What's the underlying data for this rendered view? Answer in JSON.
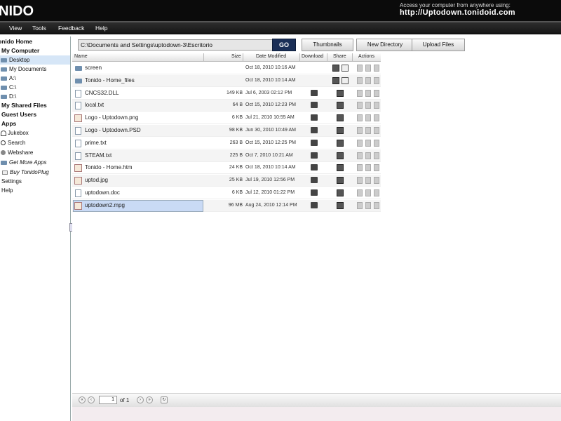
{
  "header": {
    "logo": "NIDO",
    "access_text": "Access your computer from anywhere using:",
    "access_url": "http://Uptodown.tonidoid.com"
  },
  "menu": [
    "View",
    "Tools",
    "Feedback",
    "Help"
  ],
  "sidebar": {
    "items": [
      {
        "label": "onido Home",
        "style": "bold"
      },
      {
        "label": "My Computer",
        "style": "bold"
      },
      {
        "label": "Desktop",
        "style": "selected",
        "icon": "folder-icon"
      },
      {
        "label": "My Documents",
        "icon": "folder-icon"
      },
      {
        "label": "A:\\",
        "icon": "drive-icon"
      },
      {
        "label": "C:\\",
        "icon": "drive-icon"
      },
      {
        "label": "D:\\",
        "icon": "drive-icon"
      },
      {
        "label": "My Shared Files",
        "style": "bold"
      },
      {
        "label": "Guest Users",
        "style": "bold"
      },
      {
        "label": "Apps",
        "style": "bold"
      },
      {
        "label": "Jukebox",
        "icon": "headphones-icon"
      },
      {
        "label": "Search",
        "icon": "magnifier-icon"
      },
      {
        "label": "Webshare",
        "icon": "webshare-icon"
      },
      {
        "label": "Get More Apps",
        "style": "italic",
        "icon": "apps-icon"
      },
      {
        "label": "Buy TonidoPlug",
        "style": "italic",
        "icon": "plug-icon"
      },
      {
        "label": "Settings"
      },
      {
        "label": "Help"
      }
    ]
  },
  "toolbar": {
    "path": "C:\\Documents and Settings\\uptodown-3\\Escritorio",
    "go_label": "GO",
    "thumbnails_label": "Thumbnails",
    "new_directory_label": "New Directory",
    "upload_label": "Upload Files"
  },
  "table": {
    "headers": {
      "name": "Name",
      "size": "Size",
      "date": "Date Modified",
      "download": "Download",
      "share": "Share",
      "actions": "Actions"
    },
    "rows": [
      {
        "name": "screen",
        "size": "",
        "date": "Oct 18, 2010 10:16 AM",
        "type": "folder"
      },
      {
        "name": "Tonido - Home_files",
        "size": "",
        "date": "Oct 18, 2010 10:14 AM",
        "type": "folder"
      },
      {
        "name": "CNCS32.DLL",
        "size": "149 KB",
        "date": "Jul 6, 2003 02:12 PM",
        "type": "file"
      },
      {
        "name": "local.txt",
        "size": "64 B",
        "date": "Oct 15, 2010 12:23 PM",
        "type": "file"
      },
      {
        "name": "Logo - Uptodown.png",
        "size": "6 KB",
        "date": "Jul 21, 2010 10:55 AM",
        "type": "image"
      },
      {
        "name": "Logo - Uptodown.PSD",
        "size": "98 KB",
        "date": "Jun 30, 2010 10:49 AM",
        "type": "file"
      },
      {
        "name": "prime.txt",
        "size": "263 B",
        "date": "Oct 15, 2010 12:25 PM",
        "type": "file"
      },
      {
        "name": "STEAM.txt",
        "size": "225 B",
        "date": "Oct 7, 2010 10:21 AM",
        "type": "file"
      },
      {
        "name": "Tonido - Home.htm",
        "size": "24 KB",
        "date": "Oct 18, 2010 10:14 AM",
        "type": "web"
      },
      {
        "name": "uptod.jpg",
        "size": "25 KB",
        "date": "Jul 19, 2010 12:56 PM",
        "type": "image"
      },
      {
        "name": "uptodown.doc",
        "size": "6 KB",
        "date": "Jul 12, 2010 01:22 PM",
        "type": "doc"
      },
      {
        "name": "uptodown2.mpg",
        "size": "96 MB",
        "date": "Aug 24, 2010 12:14 PM",
        "type": "video",
        "selected": true
      }
    ]
  },
  "pager": {
    "page": "1",
    "of_label": "of 1"
  }
}
